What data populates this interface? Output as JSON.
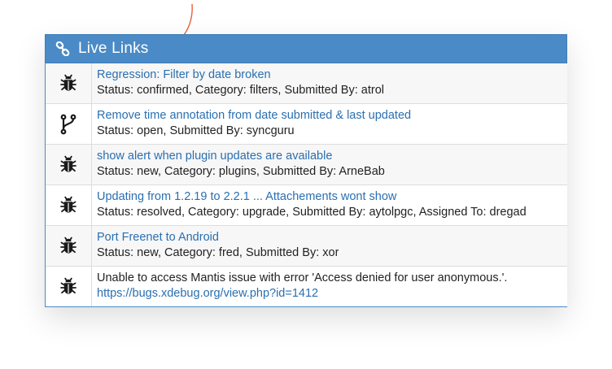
{
  "panel": {
    "title": "Live Links",
    "header_color": "#4a8ac6",
    "link_color": "#2a6fb0",
    "icon": "link-icon"
  },
  "rows": [
    {
      "icon": "bug-icon",
      "title": "Regression: Filter by date broken",
      "is_link": true,
      "detail": "Status: confirmed, Category: filters, Submitted By: atrol"
    },
    {
      "icon": "branch-icon",
      "title": "Remove time annotation from date submitted & last updated",
      "is_link": true,
      "detail": "Status: open, Submitted By: syncguru"
    },
    {
      "icon": "bug-icon",
      "title": "show alert when plugin updates are available",
      "is_link": true,
      "detail": "Status: new, Category: plugins, Submitted By: ArneBab"
    },
    {
      "icon": "bug-icon",
      "title": "Updating from 1.2.19 to 2.2.1 ... Attachements wont show",
      "is_link": true,
      "detail": "Status: resolved, Category: upgrade, Submitted By: aytolpgc, Assigned To: dregad"
    },
    {
      "icon": "bug-icon",
      "title": "Port Freenet to Android",
      "is_link": true,
      "detail": "Status: new, Category: fred, Submitted By: xor"
    },
    {
      "icon": "bug-icon",
      "title": "Unable to access Mantis issue with error 'Access denied for user anonymous.'.",
      "is_link": false,
      "detail": "https://bugs.xdebug.org/view.php?id=1412",
      "detail_is_link": true
    }
  ]
}
